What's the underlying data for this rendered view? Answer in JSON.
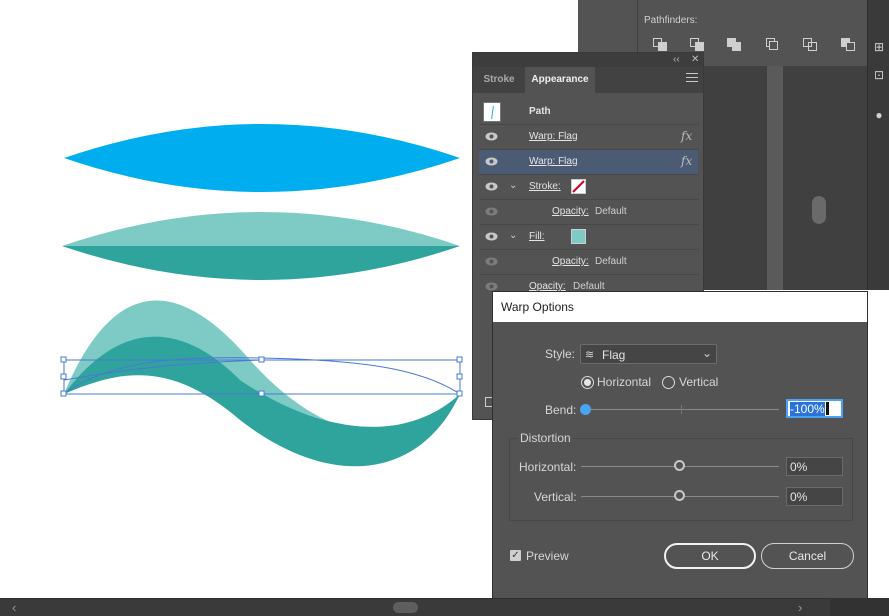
{
  "panels": {
    "pathfinder": {
      "title": "Pathfinders:"
    },
    "appearance": {
      "tabs": [
        {
          "label": "Stroke"
        },
        {
          "label": "Appearance"
        }
      ],
      "rows": {
        "path": {
          "label": "Path"
        },
        "warp1": {
          "label": "Warp: Flag",
          "fx": "fx"
        },
        "warp2": {
          "label": "Warp: Flag",
          "fx": "fx"
        },
        "stroke": {
          "label": "Stroke:",
          "chevron": "⌄"
        },
        "stroke_opacity": {
          "label": "Opacity:",
          "value": "Default"
        },
        "fill": {
          "label": "Fill:",
          "chevron": "⌄"
        },
        "fill_opacity": {
          "label": "Opacity:",
          "value": "Default"
        },
        "opacity": {
          "label": "Opacity:",
          "value": "Default"
        }
      },
      "fill_swatch_color": "#7ecbc6",
      "selected_row_color": "#4b5b73"
    }
  },
  "warp_dialog": {
    "title": "Warp Options",
    "style_label": "Style:",
    "style_value": "Flag",
    "orientation": {
      "horizontal": "Horizontal",
      "vertical": "Vertical",
      "selected": "horizontal"
    },
    "bend_label": "Bend:",
    "bend_value": "-100%",
    "distortion": {
      "legend": "Distortion",
      "horizontal_label": "Horizontal:",
      "horizontal_value": "0%",
      "vertical_label": "Vertical:",
      "vertical_value": "0%"
    },
    "preview_label": "Preview",
    "preview_checked": true,
    "ok_label": "OK",
    "cancel_label": "Cancel"
  },
  "artwork": {
    "colors": {
      "blue": "#00adee",
      "teal_light": "#7ecbc6",
      "teal_dark": "#2fa49d",
      "selection": "#4a78d4"
    }
  },
  "scrollbar": {
    "left_arrow": "‹",
    "right_arrow": "›"
  }
}
